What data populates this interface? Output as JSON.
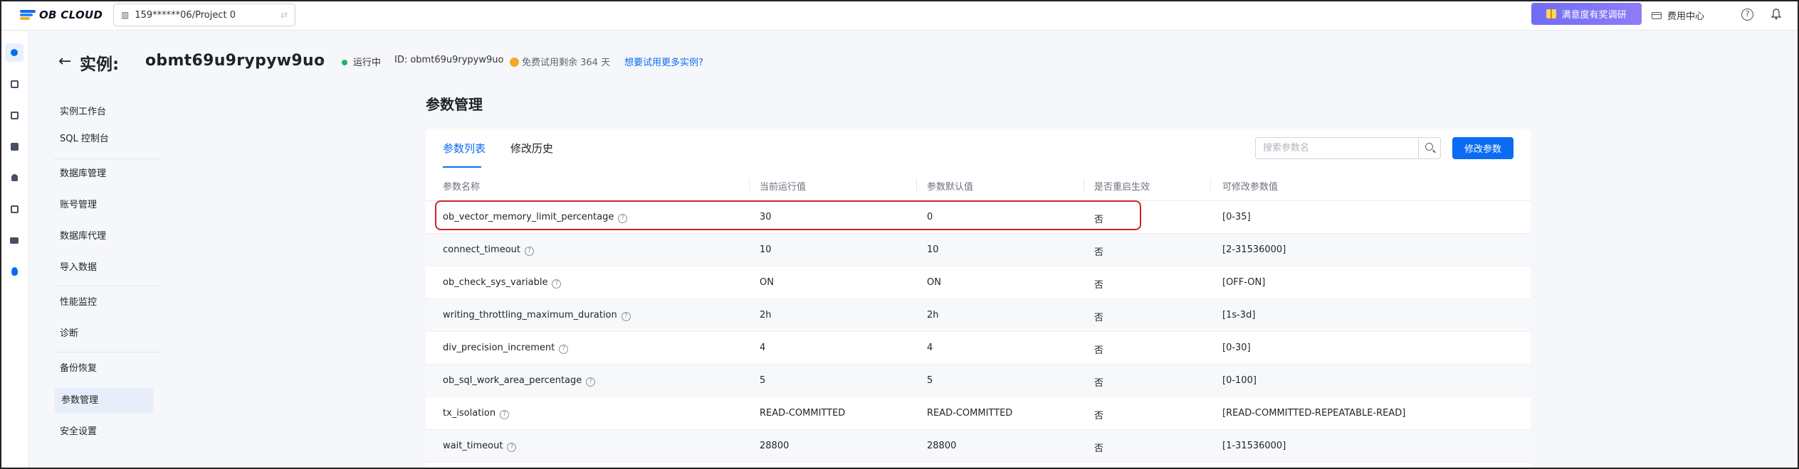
{
  "topbar": {
    "logo_text": "OB CLOUD",
    "project_selector": "159******06/Project 0",
    "survey_button": "满意度有奖调研",
    "fee_center": "费用中心"
  },
  "instance": {
    "back_label": "←",
    "label": "实例:",
    "name": "obmt69u9rypyw9uo",
    "caret": "⌄",
    "status": "运行中",
    "id_text": "ID: obmt69u9rypyw9uo",
    "trial_text": "免费试用剩余 364 天",
    "trial_link": "想要试用更多实例?"
  },
  "subnav": {
    "items": [
      {
        "label": "实例工作台"
      },
      {
        "label": "SQL 控制台"
      },
      {
        "label": "数据库管理"
      },
      {
        "label": "账号管理"
      },
      {
        "label": "数据库代理"
      },
      {
        "label": "导入数据"
      },
      {
        "label": "性能监控"
      },
      {
        "label": "诊断"
      },
      {
        "label": "备份恢复"
      },
      {
        "label": "参数管理"
      },
      {
        "label": "安全设置"
      }
    ],
    "active": "参数管理"
  },
  "main": {
    "title": "参数管理",
    "tabs": [
      {
        "label": "参数列表"
      },
      {
        "label": "修改历史"
      }
    ],
    "active_tab": "参数列表",
    "search": {
      "placeholder": "搜索参数名"
    },
    "edit_button": "修改参数"
  },
  "table": {
    "columns": [
      "参数名称",
      "当前运行值",
      "参数默认值",
      "是否重启生效",
      "可修改参数值"
    ],
    "rows": [
      {
        "name": "ob_vector_memory_limit_percentage",
        "current": "30",
        "default": "0",
        "restart": "否",
        "range": "[0-35]",
        "highlighted": true
      },
      {
        "name": "connect_timeout",
        "current": "10",
        "default": "10",
        "restart": "否",
        "range": "[2-31536000]"
      },
      {
        "name": "ob_check_sys_variable",
        "current": "ON",
        "default": "ON",
        "restart": "否",
        "range": "[OFF-ON]"
      },
      {
        "name": "writing_throttling_maximum_duration",
        "current": "2h",
        "default": "2h",
        "restart": "否",
        "range": "[1s-3d]"
      },
      {
        "name": "div_precision_increment",
        "current": "4",
        "default": "4",
        "restart": "否",
        "range": "[0-30]"
      },
      {
        "name": "ob_sql_work_area_percentage",
        "current": "5",
        "default": "5",
        "restart": "否",
        "range": "[0-100]"
      },
      {
        "name": "tx_isolation",
        "current": "READ-COMMITTED",
        "default": "READ-COMMITTED",
        "restart": "否",
        "range": "[READ-COMMITTED-REPEATABLE-READ]"
      },
      {
        "name": "wait_timeout",
        "current": "28800",
        "default": "28800",
        "restart": "否",
        "range": "[1-31536000]"
      }
    ]
  },
  "colors": {
    "primary": "#0b6cf2",
    "running": "#20b26c",
    "trial": "#f7a826",
    "highlight_box": "#cc2222"
  }
}
